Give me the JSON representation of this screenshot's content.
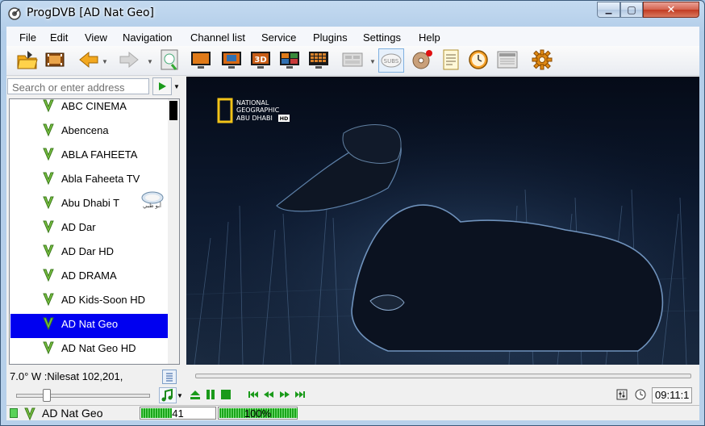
{
  "window": {
    "title": "ProgDVB [AD Nat Geo]",
    "min_glyph": "▁",
    "max_glyph": "▢",
    "close_glyph": "✕"
  },
  "menu": [
    "File",
    "Edit",
    "View",
    "Navigation",
    "Channel list",
    "Service",
    "Plugins",
    "Settings",
    "Help"
  ],
  "toolbar": {
    "icons": [
      "open-folder-icon",
      "recordings-icon",
      "back-arrow-icon",
      "forward-arrow-icon",
      "epg-icon",
      "screen-normal-icon",
      "screen-window-icon",
      "screen-3d-icon",
      "screen-pip-icon",
      "screen-mosaic-icon",
      "teletext-icon",
      "subtitles-icon",
      "record-disc-icon",
      "notes-icon",
      "scheduler-clock-icon",
      "info-panel-icon",
      "settings-gear-icon"
    ],
    "subs_label": "SUBS",
    "screen_3d_label": "3D"
  },
  "search": {
    "placeholder": "Search or enter address",
    "value": ""
  },
  "channels": [
    {
      "name": "ABC CINEMA",
      "selected": false
    },
    {
      "name": "Abencena",
      "selected": false
    },
    {
      "name": "ABLA FAHEETA",
      "selected": false
    },
    {
      "name": "Abla Faheeta TV",
      "selected": false
    },
    {
      "name": "Abu Dhabi T",
      "selected": false,
      "logo_text": "أبو ظبي"
    },
    {
      "name": "AD Dar",
      "selected": false
    },
    {
      "name": "AD Dar HD",
      "selected": false
    },
    {
      "name": "AD DRAMA",
      "selected": false
    },
    {
      "name": "AD Kids-Soon HD",
      "selected": false
    },
    {
      "name": "AD Nat Geo",
      "selected": true
    },
    {
      "name": "AD Nat Geo HD",
      "selected": false
    }
  ],
  "video": {
    "logo_line1": "NATIONAL",
    "logo_line2": "GEOGRAPHIC",
    "logo_line3": "ABU DHABI",
    "logo_badge": "HD"
  },
  "status": {
    "satellite_position": "7.0° W :Nilesat 102,201,",
    "clock": "09:11:1",
    "current_channel": "AD Nat Geo",
    "signal_level": "41",
    "signal_level_value": 41,
    "signal_quality": "100%",
    "signal_quality_value": 100
  },
  "volume": {
    "level": 0.2
  },
  "colors": {
    "selection": "#0000f0",
    "accent_green": "#1aa51a",
    "title_bar": "#b7d0ea",
    "close_button": "#c23b22"
  }
}
